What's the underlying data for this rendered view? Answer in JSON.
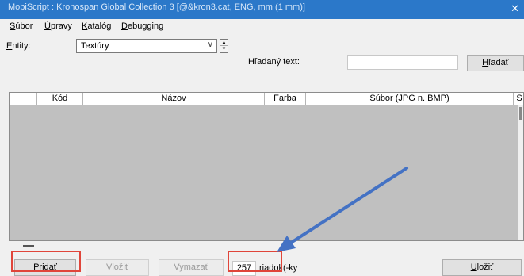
{
  "window": {
    "title": "MobiScript : Kronospan Global Collection 3  [@&kron3.cat, ENG, mm (1 mm)]",
    "close_label": "✕"
  },
  "menu": {
    "items": [
      {
        "label_u": "S",
        "label_rest": "úbor"
      },
      {
        "label_u": "Ú",
        "label_rest": "pravy"
      },
      {
        "label_u": "K",
        "label_rest": "atalóg"
      },
      {
        "label_u": "D",
        "label_rest": "ebugging"
      }
    ]
  },
  "filter": {
    "entity_label_u": "E",
    "entity_label_rest": "ntity:",
    "entity_value": "Textúry",
    "search_label": "Hľadaný text:",
    "search_value": "",
    "search_button_u": "H",
    "search_button_rest": "ľadať"
  },
  "grid": {
    "columns": [
      "",
      "Kód",
      "Názov",
      "Farba",
      "Súbor (JPG n. BMP)",
      "S"
    ],
    "rows": []
  },
  "footer": {
    "add_button_before": "Prid",
    "add_button_u": "a",
    "add_button_after": "ť",
    "insert_button": "Vložiť",
    "delete_button": "Vymazať",
    "row_count": "257",
    "rows_label": "riadok(-ky",
    "save_button_u": "U",
    "save_button_rest": "ložiť"
  },
  "annotation": {
    "highlight_color": "#e0453a",
    "arrow_color": "#4472c4"
  }
}
